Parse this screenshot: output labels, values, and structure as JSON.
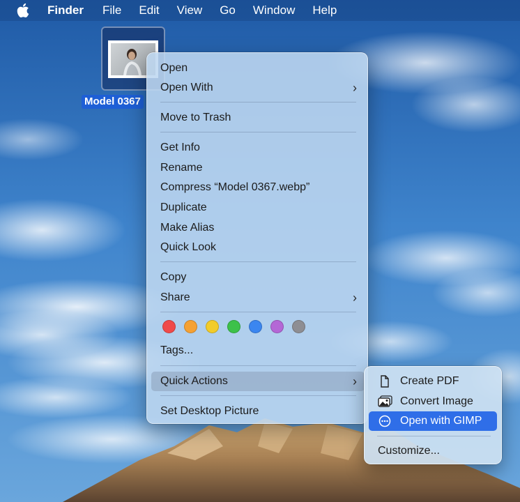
{
  "menubar": {
    "items": [
      "Finder",
      "File",
      "Edit",
      "View",
      "Go",
      "Window",
      "Help"
    ]
  },
  "desktop": {
    "file_name": "Model 0367"
  },
  "context_menu": {
    "open": "Open",
    "open_with": "Open With",
    "move_to_trash": "Move to Trash",
    "get_info": "Get Info",
    "rename": "Rename",
    "compress": "Compress “Model 0367.webp”",
    "duplicate": "Duplicate",
    "make_alias": "Make Alias",
    "quick_look": "Quick Look",
    "copy": "Copy",
    "share": "Share",
    "tags": "Tags...",
    "quick_actions": "Quick Actions",
    "set_desktop_picture": "Set Desktop Picture",
    "tag_colors": [
      "#f04a4a",
      "#f5a133",
      "#f2cc2a",
      "#3dc14a",
      "#3b86f0",
      "#b467d6",
      "#8e8e93"
    ]
  },
  "quick_actions_submenu": {
    "create_pdf": "Create PDF",
    "convert_image": "Convert Image",
    "open_with_gimp": "Open with GIMP",
    "customize": "Customize..."
  },
  "colors": {
    "selection_accent": "#2f6ee8",
    "filename_highlight": "#1e5fd6"
  }
}
